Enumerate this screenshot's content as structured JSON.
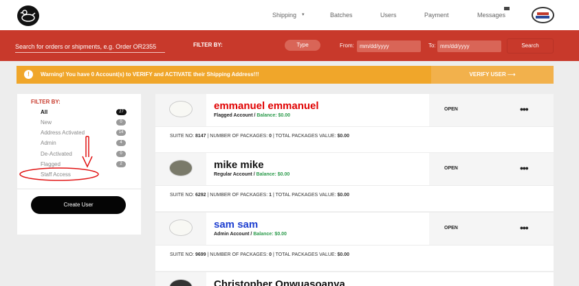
{
  "nav": {
    "logo_icon": "duck-logo-icon",
    "links": [
      {
        "label": "Shipping"
      },
      {
        "label": "Batches"
      },
      {
        "label": "Users"
      },
      {
        "label": "Payment"
      },
      {
        "label": "Messages"
      }
    ],
    "shipping_caret": "▾"
  },
  "search": {
    "placeholder": "Search for orders or shipments, e.g. Order OR2355",
    "filter_label": "FILTER BY:",
    "type_label": "Type",
    "from_label": "From:",
    "to_label": "To:",
    "from_placeholder": "mm/dd/yyyy",
    "to_placeholder": "mm/dd/yyyy",
    "button_label": "Search"
  },
  "warning": {
    "icon": "!",
    "text": "Warning! You have 0 Account(s) to VERIFY and ACTIVATE their Shipping Address!!!",
    "button_label": "VERIFY USER  ⟶"
  },
  "sidebar": {
    "title": "FILTER BY:",
    "items": [
      {
        "label": "All",
        "count": "27"
      },
      {
        "label": "New",
        "count": "0"
      },
      {
        "label": "Address Activated",
        "count": "14"
      },
      {
        "label": "Admin",
        "count": "4"
      },
      {
        "label": "De-Activated",
        "count": "0"
      },
      {
        "label": "Flagged",
        "count": "2"
      },
      {
        "label": "Staff Access"
      }
    ],
    "create_button": "Create User"
  },
  "colors": {
    "accent_red": "#c8392b",
    "warning_orange": "#f0a62a",
    "name_red": "#e00000",
    "name_blue": "#1e3fd0",
    "balance_green": "#2a9a4a"
  },
  "users": [
    {
      "name": "emmanuel emmanuel",
      "name_color": "#e00000",
      "account": "Flagged Account /",
      "balance": "Balance: $0.00",
      "status": "OPEN",
      "menu": "•••",
      "suite_label": "SUITE NO:",
      "suite": "8147",
      "packages_label": "| NUMBER OF PACKAGES:",
      "packages": "0",
      "value_label": "| TOTAL PACKAGES VALUE:",
      "value": "$0.00"
    },
    {
      "name": "mike mike",
      "name_color": "#111111",
      "account": "Regular Account /",
      "balance": "Balance: $0.00",
      "status": "OPEN",
      "menu": "•••",
      "suite_label": "SUITE NO:",
      "suite": "6292",
      "packages_label": "| NUMBER OF PACKAGES:",
      "packages": "1",
      "value_label": "| TOTAL PACKAGES VALUE:",
      "value": "$0.00"
    },
    {
      "name": "sam sam",
      "name_color": "#1e3fd0",
      "account": "Admin Account /",
      "balance": "Balance: $0.00",
      "status": "OPEN",
      "menu": "•••",
      "suite_label": "SUITE NO:",
      "suite": "9699",
      "packages_label": "| NUMBER OF PACKAGES:",
      "packages": "0",
      "value_label": "| TOTAL PACKAGES VALUE:",
      "value": "$0.00"
    },
    {
      "name": "Christopher Onwuasoanya",
      "name_color": "#111111"
    }
  ]
}
